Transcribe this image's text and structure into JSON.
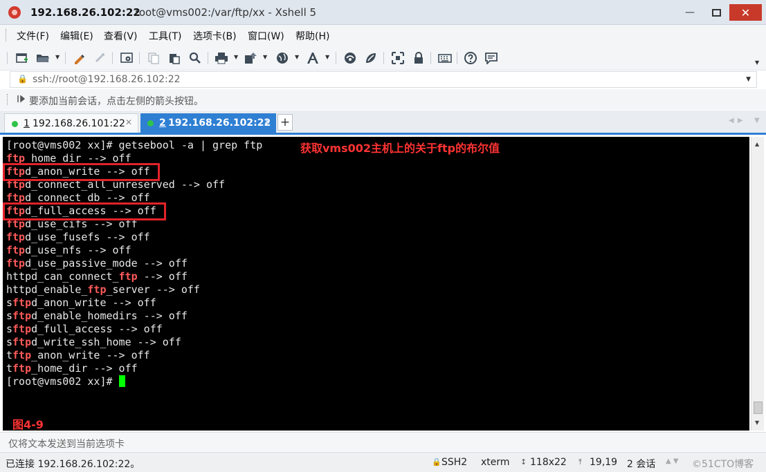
{
  "window": {
    "title_ip": "192.168.26.102:22",
    "title_rest": "root@vms002:/var/ftp/xx - Xshell 5",
    "minimize": "—",
    "close": "✕"
  },
  "menu": [
    "文件(F)",
    "编辑(E)",
    "查看(V)",
    "工具(T)",
    "选项卡(B)",
    "窗口(W)",
    "帮助(H)"
  ],
  "toolbar_icons": [
    "new-session-icon",
    "open-folder-icon",
    "properties-icon",
    "disconnect-icon",
    "settings-icon",
    "copy-icon",
    "paste-icon",
    "find-icon",
    "print-icon",
    "transfer-icon",
    "globe-icon",
    "font-icon",
    "xftp-icon",
    "xmanager-icon",
    "fullscreen-icon",
    "lock-icon",
    "keyboard-icon",
    "help-icon",
    "chat-icon"
  ],
  "address": {
    "value": "ssh://root@192.168.26.102:22"
  },
  "hint": "要添加当前会话，点击左侧的箭头按钮。",
  "tabs": [
    {
      "num": "1",
      "label": "192.168.26.101:22",
      "active": false
    },
    {
      "num": "2",
      "label": "192.168.26.102:22",
      "active": true
    }
  ],
  "terminal": {
    "lines": [
      [
        {
          "t": "[root@vms002 xx]# getsebool -a | grep ftp"
        }
      ],
      [
        {
          "t": "ftp",
          "h": 1
        },
        {
          "t": "_home_dir --> off"
        }
      ],
      [
        {
          "t": "ftp",
          "h": 1
        },
        {
          "t": "d_anon_write --> off"
        }
      ],
      [
        {
          "t": "ftp",
          "h": 1
        },
        {
          "t": "d_connect_all_unreserved --> off"
        }
      ],
      [
        {
          "t": "ftp",
          "h": 1
        },
        {
          "t": "d_connect_db --> off"
        }
      ],
      [
        {
          "t": "ftp",
          "h": 1
        },
        {
          "t": "d_full_access --> off"
        }
      ],
      [
        {
          "t": "ftp",
          "h": 1
        },
        {
          "t": "d_use_cifs --> off"
        }
      ],
      [
        {
          "t": "ftp",
          "h": 1
        },
        {
          "t": "d_use_fusefs --> off"
        }
      ],
      [
        {
          "t": "ftp",
          "h": 1
        },
        {
          "t": "d_use_nfs --> off"
        }
      ],
      [
        {
          "t": "ftp",
          "h": 1
        },
        {
          "t": "d_use_passive_mode --> off"
        }
      ],
      [
        {
          "t": "httpd_can_connect_"
        },
        {
          "t": "ftp",
          "h": 1
        },
        {
          "t": " --> off"
        }
      ],
      [
        {
          "t": "httpd_enable_"
        },
        {
          "t": "ftp",
          "h": 1
        },
        {
          "t": "_server --> off"
        }
      ],
      [
        {
          "t": "s"
        },
        {
          "t": "ftp",
          "h": 1
        },
        {
          "t": "d_anon_write --> off"
        }
      ],
      [
        {
          "t": "s"
        },
        {
          "t": "ftp",
          "h": 1
        },
        {
          "t": "d_enable_homedirs --> off"
        }
      ],
      [
        {
          "t": "s"
        },
        {
          "t": "ftp",
          "h": 1
        },
        {
          "t": "d_full_access --> off"
        }
      ],
      [
        {
          "t": "s"
        },
        {
          "t": "ftp",
          "h": 1
        },
        {
          "t": "d_write_ssh_home --> off"
        }
      ],
      [
        {
          "t": "t"
        },
        {
          "t": "ftp",
          "h": 1
        },
        {
          "t": "_anon_write --> off"
        }
      ],
      [
        {
          "t": "t"
        },
        {
          "t": "ftp",
          "h": 1
        },
        {
          "t": "_home_dir --> off"
        }
      ],
      [
        {
          "t": "[root@vms002 xx]# "
        }
      ]
    ],
    "annotation": "获取vms002主机上的关于ftp的布尔值",
    "figure_label": "图4-9",
    "highlight_color": "#ff5b5b"
  },
  "compose": {
    "placeholder": "仅将文本发送到当前选项卡"
  },
  "status": {
    "connection": "已连接 192.168.26.102:22。",
    "protocol": "SSH2",
    "term_type": "xterm",
    "size": "118x22",
    "cursor_pos": "19,19",
    "sessions": "2 会话",
    "watermark": "©51CTO博客"
  }
}
